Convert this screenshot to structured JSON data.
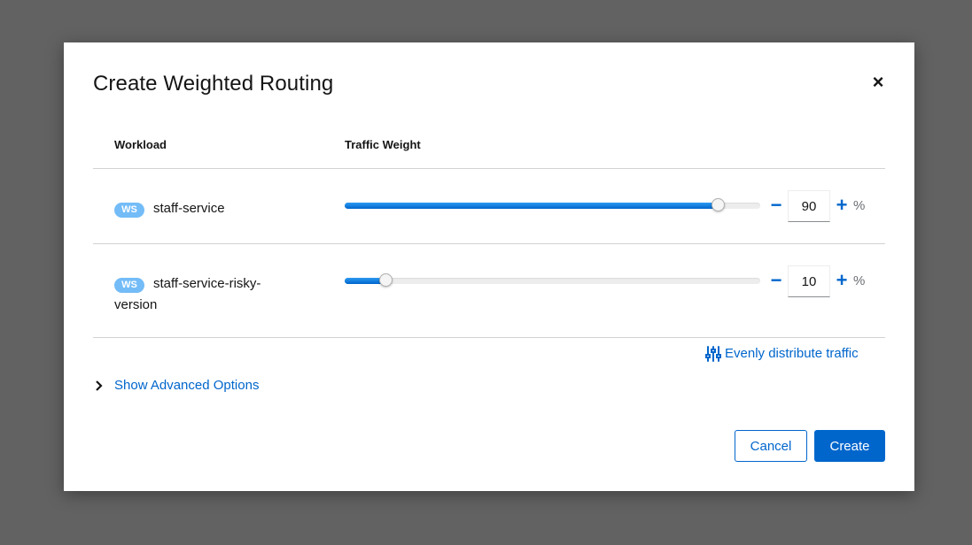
{
  "modal": {
    "title": "Create Weighted Routing",
    "close_glyph": "×"
  },
  "table": {
    "headers": [
      "Workload",
      "Traffic Weight"
    ],
    "rows": [
      {
        "badge": "WS",
        "name": "staff-service",
        "name_line2": "",
        "weight": 90,
        "unit": "%"
      },
      {
        "badge": "WS",
        "name": "staff-service-risky-",
        "name_line2": "version",
        "weight": 10,
        "unit": "%"
      }
    ]
  },
  "controls": {
    "decrement_glyph": "−",
    "increment_glyph": "+"
  },
  "evenly_distribute": {
    "label": "Evenly distribute traffic",
    "icon": "sliders-icon"
  },
  "advanced": {
    "label": "Show Advanced Options",
    "icon": "chevron-right-icon"
  },
  "footer": {
    "cancel_label": "Cancel",
    "create_label": "Create"
  },
  "colors": {
    "primary": "#0066cc",
    "badge": "#73bcf7",
    "text": "#151515"
  }
}
